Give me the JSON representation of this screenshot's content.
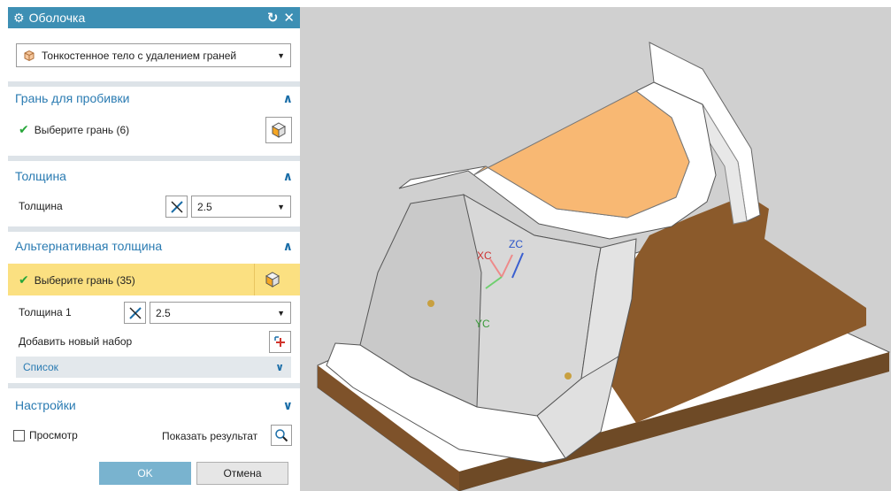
{
  "dialog": {
    "title": "Оболочка",
    "type_select": "Тонкостенное тело с удалением граней",
    "section_pierce": {
      "title": "Грань для пробивки",
      "select_label": "Выберите грань (6)"
    },
    "section_thickness": {
      "title": "Толщина",
      "label": "Толщина",
      "value": "2.5"
    },
    "section_alt": {
      "title": "Альтернативная толщина",
      "select_label": "Выберите грань (35)",
      "thickness_label": "Толщина 1",
      "thickness_value": "2.5",
      "add_set_label": "Добавить новый набор",
      "list_label": "Список"
    },
    "section_settings": {
      "title": "Настройки"
    },
    "preview_label": "Просмотр",
    "show_result_label": "Показать результат",
    "ok_label": "OK",
    "cancel_label": "Отмена"
  },
  "viewport": {
    "axis_labels": {
      "x": "XC",
      "y": "YC",
      "z": "ZC"
    }
  },
  "colors": {
    "accent": "#3d8fb4",
    "ok_button": "#79b3cf",
    "highlight_row": "#fbe081",
    "selected_face": "#f8b873",
    "base_brown": "#8b5a2b"
  }
}
